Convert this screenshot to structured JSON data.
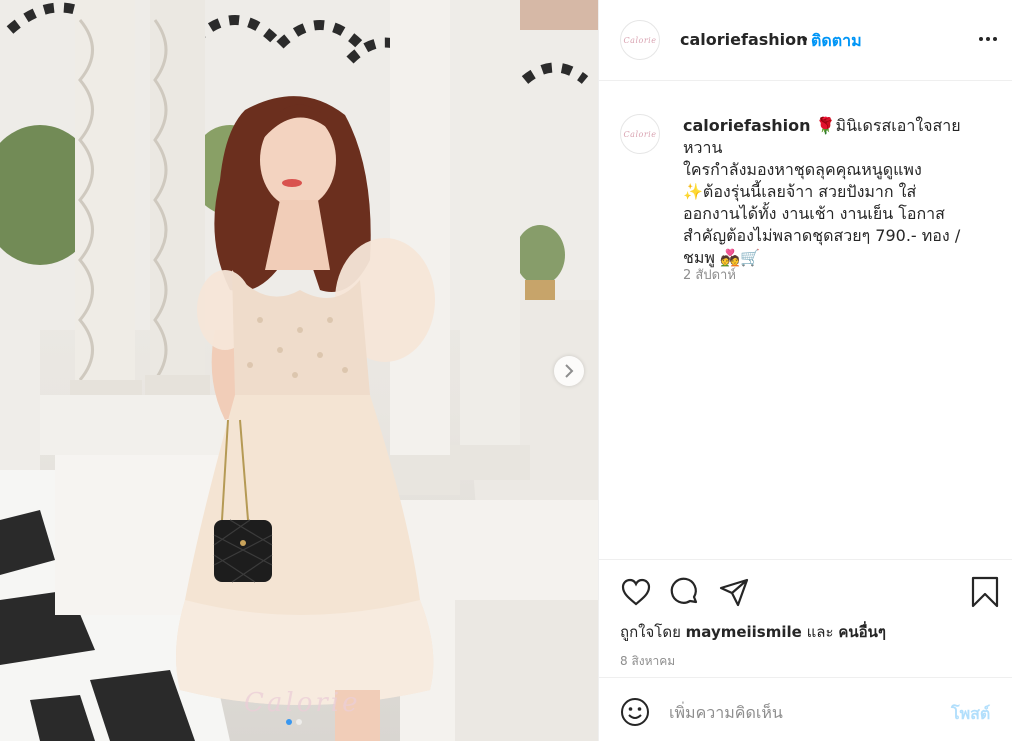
{
  "post": {
    "photo_alt": "Model in cream mini dress holding black quilted handbag among white columns",
    "watermark": "Calorie",
    "carousel": {
      "count": 2,
      "active_index": 0
    }
  },
  "header": {
    "username": "caloriefashion",
    "separator": "•",
    "follow_label": "ติดตาม",
    "avatar_text": "Calorie"
  },
  "caption": {
    "username": "caloriefashion",
    "line1": "🌹มินิเดรสเอาใจสายหวาน",
    "line2": "ใครกำลังมองหาชุดลุคคุณหนูดูแพง",
    "line3": "✨ต้องรุ่นนี้เลยจ้าา สวยปังมาก ใส่",
    "line4": "ออกงานได้ทั้ง งานเช้า งานเย็น โอกาส",
    "line5": "สำคัญต้องไม่พลาดชุดสวยๆ 790.- ทอง /",
    "line6": "ชมพู 💑🛒",
    "time": "2 สัปดาห์"
  },
  "likes": {
    "prefix": "ถูกใจโดย",
    "user": "maymeiismile",
    "and": "และ",
    "others": "คนอื่นๆ"
  },
  "date": "8 สิงหาคม",
  "comment": {
    "placeholder": "เพิ่มความคิดเห็น",
    "post_label": "โพสต์"
  },
  "icons": {
    "like": "heart-icon",
    "comment": "comment-icon",
    "share": "paper-plane-icon",
    "save": "bookmark-icon",
    "emoji": "emoji-icon",
    "more": "more-dots-icon",
    "next": "chevron-right-icon"
  },
  "colors": {
    "link_blue": "#0095f6",
    "post_disabled": "#b2dffc",
    "muted": "#8e8e8e",
    "text": "#262626"
  }
}
